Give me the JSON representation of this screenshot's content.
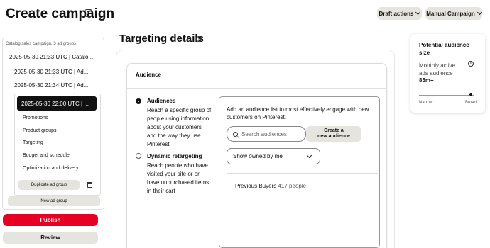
{
  "header": {
    "title": "Create campaign",
    "draft_actions": "Draft actions",
    "manual_campaign": "Manual Campaign"
  },
  "sidebar": {
    "header": "Catalog sales campaign, 3 ad groups",
    "items": [
      {
        "label": "2025-05-30 21:33 UTC | Catalo..."
      },
      {
        "label": "2025-05-30 21:33 UTC | Ad..."
      },
      {
        "label": "2025-05-30 21:34 UTC | Ad..."
      }
    ],
    "active_item": "2025-05-30 22:00 UTC | ...",
    "sub_items": [
      "Promotions",
      "Product groups",
      "Targeting",
      "Budget and schedule",
      "Optimization and delivery"
    ],
    "duplicate_label": "Duplicate ad group",
    "new_ad_group_label": "New ad group"
  },
  "actions": {
    "publish": "Publish",
    "review": "Review"
  },
  "targeting": {
    "title": "Targeting details",
    "card_title": "Audience",
    "options": [
      {
        "title": "Audiences",
        "desc": "Reach a specific group of people using information about your customers and the way they use Pinterest",
        "selected": true
      },
      {
        "title": "Dynamic retargeting",
        "desc": "Reach people who have visited your site or or have unpurchased items in their cart",
        "selected": false
      }
    ],
    "prompt": "Add an audience list to most effectively engage with new customers on Pinterest.",
    "search_placeholder": "Search audiences",
    "create_line1": "Create a",
    "create_line2": "new audience",
    "filter_selected": "Show owned by me",
    "audience_row": {
      "name": "Previous Buyers",
      "count": "417 people"
    }
  },
  "potential": {
    "title": "Potential audience size",
    "subtitle": "Monthly active ads audience",
    "value": "85m+",
    "narrow": "Narrow",
    "broad": "Broad",
    "level": 0.95
  }
}
